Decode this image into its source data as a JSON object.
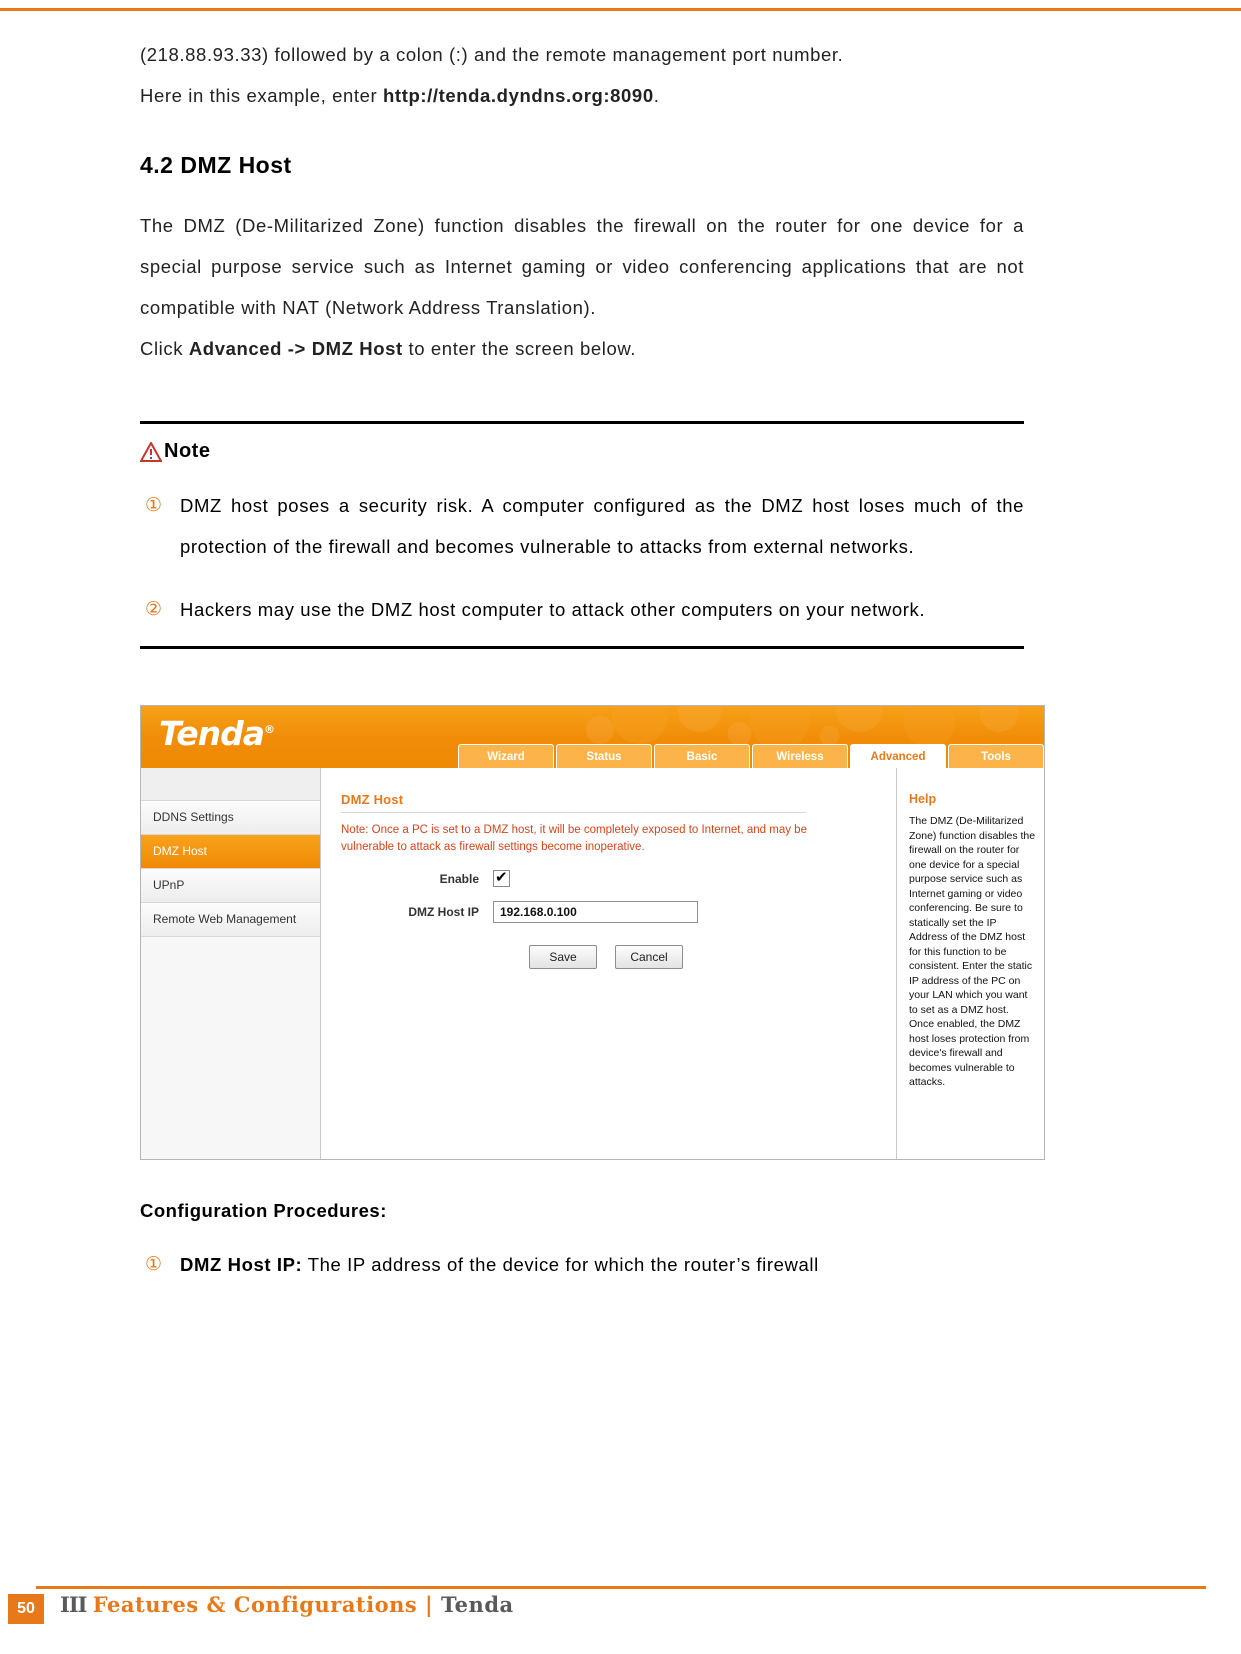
{
  "intro": {
    "line1": "(218.88.93.33) followed by a colon (:) and the remote management port number.",
    "line2_prefix": "Here in this example, enter ",
    "line2_bold": "http://tenda.dyndns.org:8090",
    "line2_suffix": "."
  },
  "section": {
    "title": "4.2 DMZ Host",
    "body": "The DMZ (De-Militarized Zone) function disables the firewall on the router for one device for a special purpose service such as Internet gaming or video conferencing applications that are not compatible with NAT (Network Address Translation).",
    "click_prefix": "Click ",
    "click_bold": "Advanced -> DMZ Host",
    "click_suffix": " to enter the screen below."
  },
  "note": {
    "label": "Note",
    "items": [
      {
        "marker": "①",
        "text": "DMZ host poses a security risk. A computer configured as the DMZ host loses much of the protection of the firewall and becomes vulnerable to attacks from external networks."
      },
      {
        "marker": "②",
        "text": "Hackers may use the DMZ host computer to attack other computers on your network."
      }
    ]
  },
  "router_ui": {
    "brand": "Tenda",
    "brand_mark": "®",
    "nav": [
      {
        "label": "Wizard",
        "active": false
      },
      {
        "label": "Status",
        "active": false
      },
      {
        "label": "Basic",
        "active": false
      },
      {
        "label": "Wireless",
        "active": false
      },
      {
        "label": "Advanced",
        "active": true
      },
      {
        "label": "Tools",
        "active": false
      }
    ],
    "side_nav": [
      {
        "label": "DDNS Settings",
        "active": false
      },
      {
        "label": "DMZ Host",
        "active": true
      },
      {
        "label": "UPnP",
        "active": false
      },
      {
        "label": "Remote Web Management",
        "active": false
      }
    ],
    "pane": {
      "title": "DMZ Host",
      "note": "Note: Once a PC is set to a DMZ host, it will be completely exposed to Internet, and may be vulnerable to attack as firewall settings become inoperative.",
      "enable_label": "Enable",
      "enable_checked": true,
      "ip_label": "DMZ Host IP",
      "ip_value": "192.168.0.100",
      "save_label": "Save",
      "cancel_label": "Cancel"
    },
    "help": {
      "title": "Help",
      "text": "The DMZ (De-Militarized Zone) function disables the firewall on the router for one device for a special purpose service such as Internet gaming or video conferencing. Be sure to statically set the IP Address of the DMZ host for this function to be consistent. Enter the static IP address of the PC on your LAN which you want to set as a DMZ host. Once enabled, the DMZ host loses protection from device's firewall and becomes vulnerable to attacks."
    }
  },
  "config": {
    "title": "Configuration Procedures:",
    "items": [
      {
        "marker": "①",
        "bold": "DMZ Host IP:",
        "text": " The IP address of the device for which the router’s firewall"
      }
    ]
  },
  "footer": {
    "page": "50",
    "bars": "III ",
    "title": "Features & Configurations | ",
    "brand": "Tenda"
  },
  "colors": {
    "accent": "#e8791b",
    "orange_header": "#f3910d",
    "note_red": "#d4451a"
  }
}
